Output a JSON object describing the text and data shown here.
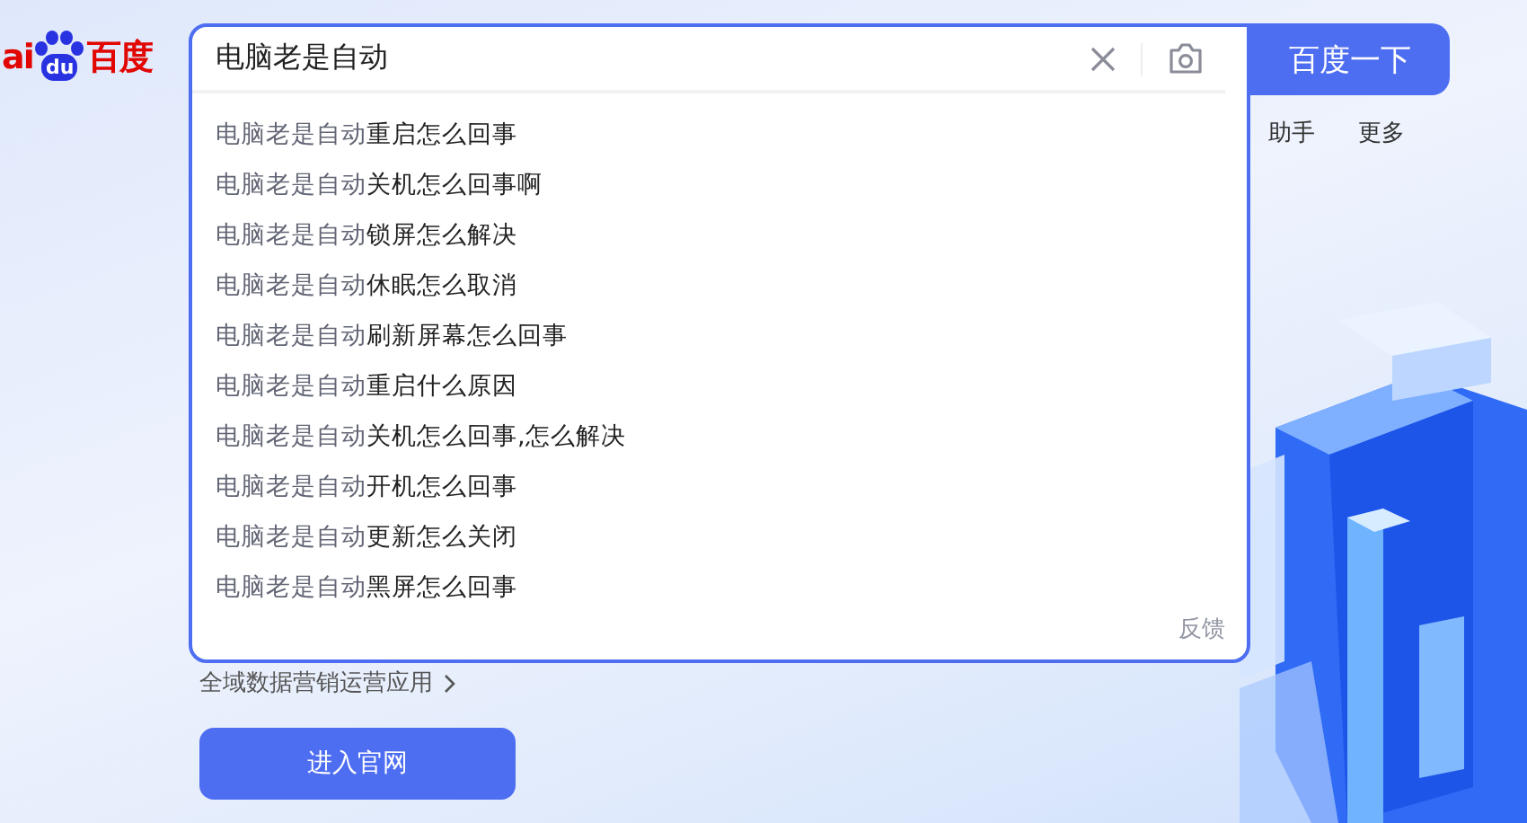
{
  "logo": {
    "text_left": "ai",
    "paw_text": "du",
    "text_right": "百度"
  },
  "search": {
    "value": "电脑老是自动",
    "button": "百度一下"
  },
  "suggestions": [
    {
      "prefix": "电脑老是自动",
      "completion": "重启怎么回事"
    },
    {
      "prefix": "电脑老是自动",
      "completion": "关机怎么回事啊"
    },
    {
      "prefix": "电脑老是自动",
      "completion": "锁屏怎么解决"
    },
    {
      "prefix": "电脑老是自动",
      "completion": "休眠怎么取消"
    },
    {
      "prefix": "电脑老是自动",
      "completion": "刷新屏幕怎么回事"
    },
    {
      "prefix": "电脑老是自动",
      "completion": "重启什么原因"
    },
    {
      "prefix": "电脑老是自动",
      "completion": "关机怎么回事,怎么解决"
    },
    {
      "prefix": "电脑老是自动",
      "completion": "开机怎么回事"
    },
    {
      "prefix": "电脑老是自动",
      "completion": "更新怎么关闭"
    },
    {
      "prefix": "电脑老是自动",
      "completion": "黑屏怎么回事"
    }
  ],
  "feedback": "反馈",
  "nav_links": [
    "助手",
    "更多"
  ],
  "promo": {
    "link": "全域数据营销运营应用",
    "button": "进入官网"
  }
}
